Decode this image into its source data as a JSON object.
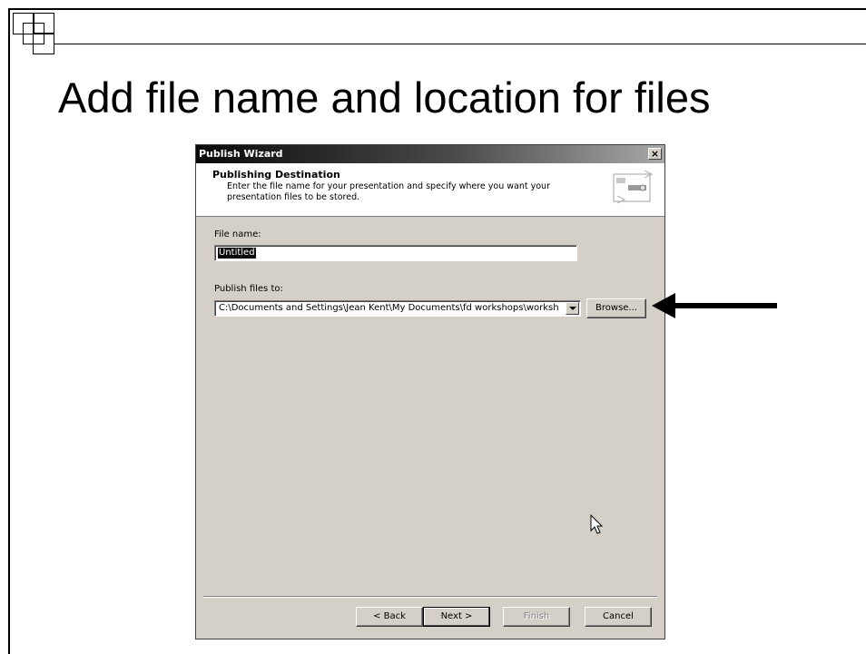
{
  "slide": {
    "title": "Add file name and location for files"
  },
  "dialog": {
    "title": "Publish Wizard",
    "close_glyph": "×",
    "header": {
      "title": "Publishing Destination",
      "description": "Enter the file name for your presentation and specify where you want your presentation files to be stored."
    },
    "file_name": {
      "label": "File name:",
      "value": "Untitled"
    },
    "publish_to": {
      "label": "Publish files to:",
      "value": "C:\\Documents and Settings\\Jean Kent\\My Documents\\fd workshops\\worksh"
    },
    "browse_label": "Browse...",
    "buttons": {
      "back": "< Back",
      "next": "Next >",
      "finish": "Finish",
      "cancel": "Cancel"
    }
  },
  "icons": [
    "close-icon",
    "publish-wizard-icon",
    "dropdown-arrow-icon",
    "annotation-arrow-icon",
    "mouse-cursor-icon"
  ],
  "colors": {
    "dialog_face": "#d4d0c8",
    "titlebar_dark": "#0a0a0a",
    "titlebar_light": "#a8a8a8",
    "selection": "#0a0a0a"
  }
}
